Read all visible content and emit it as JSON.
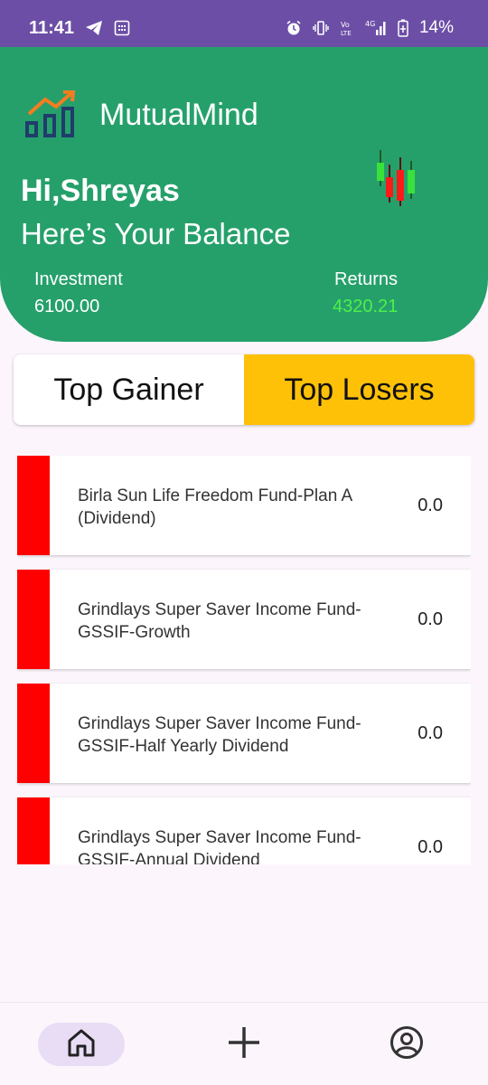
{
  "status_bar": {
    "time": "11:41",
    "battery": "14%",
    "icons": [
      "telegram-icon",
      "calendar-icon",
      "alarm-icon",
      "vibrate-icon",
      "volte-icon",
      "signal-icon",
      "battery-icon"
    ]
  },
  "header": {
    "app_name": "MutualMind",
    "greeting": "Hi,Shreyas",
    "balance_title": "Here’s Your Balance",
    "investment_label": "Investment",
    "investment_value": "6100.00",
    "returns_label": "Returns",
    "returns_value": "4320.21"
  },
  "tabs": {
    "gainer": "Top Gainer",
    "losers": "Top Losers",
    "selected": "losers"
  },
  "funds": [
    {
      "name": "Birla Sun Life Freedom Fund-Plan A (Dividend)",
      "value": "0.0"
    },
    {
      "name": "Grindlays Super Saver Income Fund-GSSIF-Growth",
      "value": "0.0"
    },
    {
      "name": "Grindlays Super Saver Income Fund-GSSIF-Half Yearly Dividend",
      "value": "0.0"
    },
    {
      "name": "Grindlays Super Saver Income Fund-GSSIF-Annual Dividend",
      "value": "0.0"
    }
  ],
  "nav": {
    "items": [
      "home-icon",
      "add-icon",
      "profile-icon"
    ],
    "active": "home"
  },
  "colors": {
    "status_bar": "#6c4ea6",
    "header": "#26a06b",
    "returns": "#4cf04a",
    "selected_tab": "#ffc107",
    "loser_bar": "#ff0000"
  }
}
